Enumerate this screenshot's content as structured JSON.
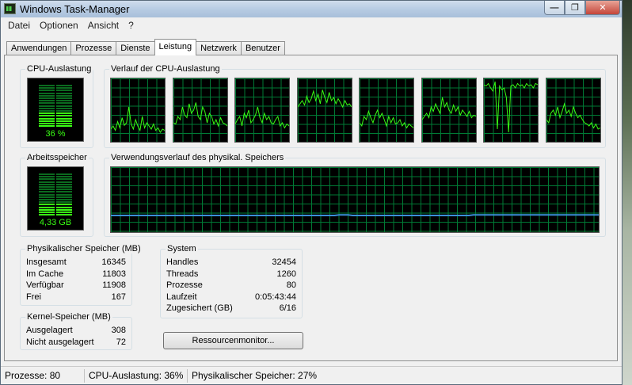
{
  "window": {
    "title": "Windows Task-Manager",
    "controls": {
      "minimize": "—",
      "maximize": "❐",
      "close": "✕"
    }
  },
  "menu": [
    "Datei",
    "Optionen",
    "Ansicht",
    "?"
  ],
  "tabs": [
    {
      "label": "Anwendungen",
      "active": false
    },
    {
      "label": "Prozesse",
      "active": false
    },
    {
      "label": "Dienste",
      "active": false
    },
    {
      "label": "Leistung",
      "active": true
    },
    {
      "label": "Netzwerk",
      "active": false
    },
    {
      "label": "Benutzer",
      "active": false
    }
  ],
  "cpu": {
    "label": "CPU-Auslastung",
    "value": "36 %",
    "percent": 36
  },
  "cpu_history": {
    "label": "Verlauf der CPU-Auslastung",
    "cores": [
      [
        20,
        25,
        18,
        32,
        22,
        38,
        26,
        30,
        55,
        28,
        20,
        35,
        25,
        18,
        40,
        22,
        30,
        25,
        20,
        28,
        18,
        22,
        15,
        20,
        18
      ],
      [
        30,
        28,
        40,
        35,
        55,
        42,
        38,
        60,
        45,
        50,
        62,
        40,
        35,
        55,
        48,
        30,
        45,
        40,
        28,
        35,
        25,
        38,
        30,
        28,
        25
      ],
      [
        28,
        35,
        40,
        25,
        45,
        38,
        50,
        30,
        35,
        42,
        55,
        38,
        30,
        45,
        35,
        40,
        30,
        28,
        35,
        40,
        25,
        30,
        22,
        28,
        25
      ],
      [
        55,
        60,
        65,
        58,
        72,
        62,
        68,
        80,
        65,
        75,
        60,
        82,
        70,
        62,
        78,
        65,
        70,
        60,
        68,
        62,
        55,
        65,
        58,
        60,
        55
      ],
      [
        30,
        25,
        40,
        35,
        48,
        38,
        30,
        42,
        50,
        38,
        45,
        35,
        25,
        40,
        30,
        38,
        28,
        30,
        35,
        25,
        30,
        22,
        28,
        25,
        22
      ],
      [
        35,
        40,
        45,
        38,
        55,
        48,
        60,
        52,
        45,
        70,
        55,
        62,
        50,
        45,
        58,
        48,
        55,
        42,
        50,
        45,
        40,
        48,
        38,
        42,
        40
      ],
      [
        90,
        88,
        92,
        85,
        80,
        95,
        20,
        88,
        82,
        85,
        70,
        15,
        88,
        90,
        85,
        92,
        88,
        90,
        85,
        92,
        88,
        90,
        85,
        92,
        90
      ],
      [
        35,
        30,
        45,
        50,
        42,
        55,
        38,
        48,
        60,
        45,
        50,
        40,
        55,
        45,
        38,
        42,
        35,
        30,
        28,
        25,
        30,
        22,
        28,
        20,
        22
      ]
    ]
  },
  "memory": {
    "label": "Arbeitsspeicher",
    "value": "4,33 GB",
    "percent": 27
  },
  "memory_history": {
    "label": "Verwendungsverlauf des physikal. Speichers",
    "values": [
      27,
      27,
      27,
      27,
      27,
      27,
      27,
      27,
      27,
      27,
      27,
      27,
      27,
      27,
      27,
      27,
      27,
      27,
      27,
      27,
      27,
      27,
      27,
      27,
      27,
      27,
      27,
      27,
      27,
      27,
      27,
      27,
      27,
      27,
      27,
      27,
      27,
      27,
      27,
      27,
      27,
      27,
      27,
      27,
      27,
      27,
      27,
      27,
      27,
      27,
      27,
      28,
      28,
      28,
      27,
      27,
      27,
      27,
      27,
      27,
      27,
      27,
      27,
      27,
      27,
      27,
      27,
      27,
      27,
      27,
      27,
      27,
      27,
      27,
      27,
      27,
      27,
      27,
      27,
      27,
      27,
      28,
      28,
      28,
      28,
      28,
      28,
      28,
      28,
      28,
      28,
      28,
      28,
      28,
      28,
      28,
      28,
      28,
      28,
      28,
      28,
      28,
      28,
      28,
      28,
      28,
      28,
      28,
      28,
      28
    ]
  },
  "physical": {
    "label": "Physikalischer Speicher (MB)",
    "rows": [
      {
        "label": "Insgesamt",
        "value": "16345"
      },
      {
        "label": "Im Cache",
        "value": "11803"
      },
      {
        "label": "Verfügbar",
        "value": "11908"
      },
      {
        "label": "Frei",
        "value": "167"
      }
    ]
  },
  "kernel": {
    "label": "Kernel-Speicher (MB)",
    "rows": [
      {
        "label": "Ausgelagert",
        "value": "308"
      },
      {
        "label": "Nicht ausgelagert",
        "value": "72"
      }
    ]
  },
  "system": {
    "label": "System",
    "rows": [
      {
        "label": "Handles",
        "value": "32454"
      },
      {
        "label": "Threads",
        "value": "1260"
      },
      {
        "label": "Prozesse",
        "value": "80"
      },
      {
        "label": "Laufzeit",
        "value": "0:05:43:44"
      },
      {
        "label": "Zugesichert (GB)",
        "value": "6/16"
      }
    ]
  },
  "resmon_button": "Ressourcenmonitor...",
  "status": [
    "Prozesse: 80",
    "CPU-Auslastung: 36%",
    "Physikalischer Speicher: 27%"
  ],
  "colors": {
    "graph_line": "#39ff14",
    "memory_line": "#3a8fd8",
    "grid": "#007a35"
  }
}
